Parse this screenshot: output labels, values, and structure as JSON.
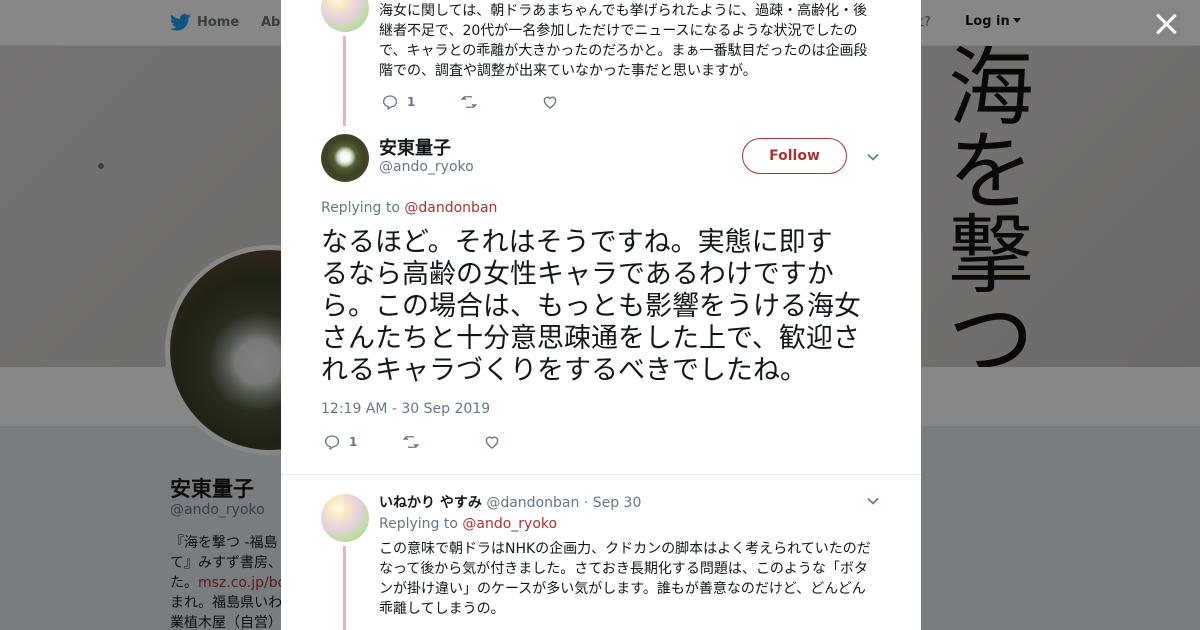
{
  "topbar": {
    "home_label": "Home",
    "about_label": "Abo",
    "account_prompt": "ccount?",
    "login_label": "Log in"
  },
  "banner": {
    "text_chars": [
      "海",
      "を",
      "撃",
      "つ"
    ]
  },
  "profile": {
    "name": "安東量子",
    "handle": "@ando_ryoko",
    "bio_lines": [
      "『海を撃つ -福島",
      "て』みすず書房、",
      "た。",
      "まれ。福島県いわ",
      "業植木屋（自営）"
    ],
    "bio_link": "msz.co.jp/boo"
  },
  "modal": {
    "prev_tweet": {
      "lines": [
        "海女に関しては、朝ドラあまちゃんでも挙げられたように、過疎・高齢化・後",
        "継者不足で、20代が一名参加しただけでニュースになるような状況でしたの",
        "で、キャラとの乖離が大きかったのだろかと。まぁ一番駄目だったのは企画段",
        "階での、調査や調整が出来ていなかった事だと思いますが。"
      ],
      "reply_count": "1"
    },
    "main_tweet": {
      "name": "安東量子",
      "handle": "@ando_ryoko",
      "follow_label": "Follow",
      "replying_prefix": "Replying to",
      "replying_to": "@dandonban",
      "lines": [
        "なるほど。それはそうですね。実態に即す",
        "るなら高齢の女性キャラであるわけですか",
        "ら。この場合は、もっとも影響をうける海女",
        "さんたちと十分意思疎通をした上で、歓迎さ",
        "れるキャラづくりをするべきでしたね。"
      ],
      "timestamp": "12:19 AM - 30 Sep 2019",
      "reply_count": "1"
    },
    "reply_tweet": {
      "name": "いねかり やすみ",
      "handle": "@dandonban",
      "time": "· Sep 30",
      "replying_prefix": "Replying to",
      "replying_to": "@ando_ryoko",
      "lines": [
        "この意味で朝ドラはNHKの企画力、クドカンの脚本はよく考えられていたのだ",
        "なって後から気が付きました。さておき長期化する問題は、このような「ボタ",
        "ンが掛け違い」のケースが多い気がします。誰もが善意なのだけど、どんどん",
        "乖離してしまうの。"
      ]
    }
  },
  "colors": {
    "accent": "#aa3333",
    "muted": "#657786",
    "thread_line": "#e0b7bd",
    "twitter_blue": "#1da1f2"
  },
  "icons": [
    "twitter-bird-icon",
    "close-icon",
    "reply-icon",
    "retweet-icon",
    "like-icon",
    "chevron-down-icon"
  ]
}
